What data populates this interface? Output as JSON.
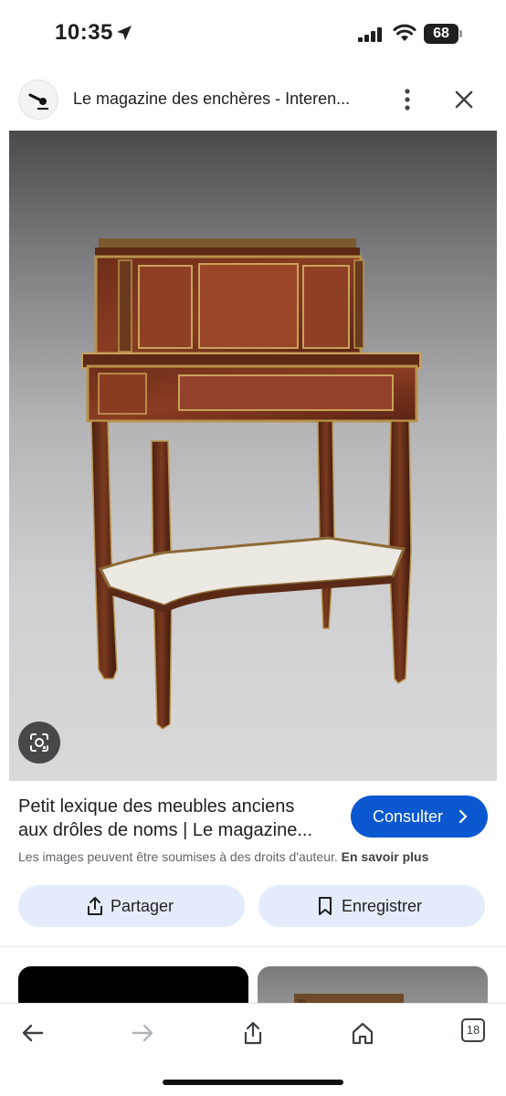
{
  "status_bar": {
    "time": "10:35",
    "battery": "68",
    "icons": [
      "location-arrow-icon",
      "signal-icon",
      "wifi-icon",
      "battery-icon"
    ]
  },
  "header": {
    "title": "Le magazine des enchères - Interen...",
    "icons": [
      "site-logo",
      "more-vert-icon",
      "close-icon"
    ]
  },
  "image": {
    "lens_icon": "google-lens-icon"
  },
  "result": {
    "title_line1": "Petit lexique des meubles anciens",
    "title_line2": "aux drôles de noms | Le magazine...",
    "consult_label": "Consulter",
    "copyright_text": "Les images peuvent être soumises à des droits d'auteur.",
    "learn_more": "En savoir plus"
  },
  "actions": {
    "share_label": "Partager",
    "save_label": "Enregistrer"
  },
  "toolbar": {
    "tabs_count": "18",
    "icons": [
      "back-arrow-icon",
      "forward-arrow-icon",
      "share-icon",
      "home-icon",
      "tabs-icon"
    ]
  },
  "colors": {
    "accent": "#0b57d0",
    "action_bg": "#e4ecfb"
  }
}
